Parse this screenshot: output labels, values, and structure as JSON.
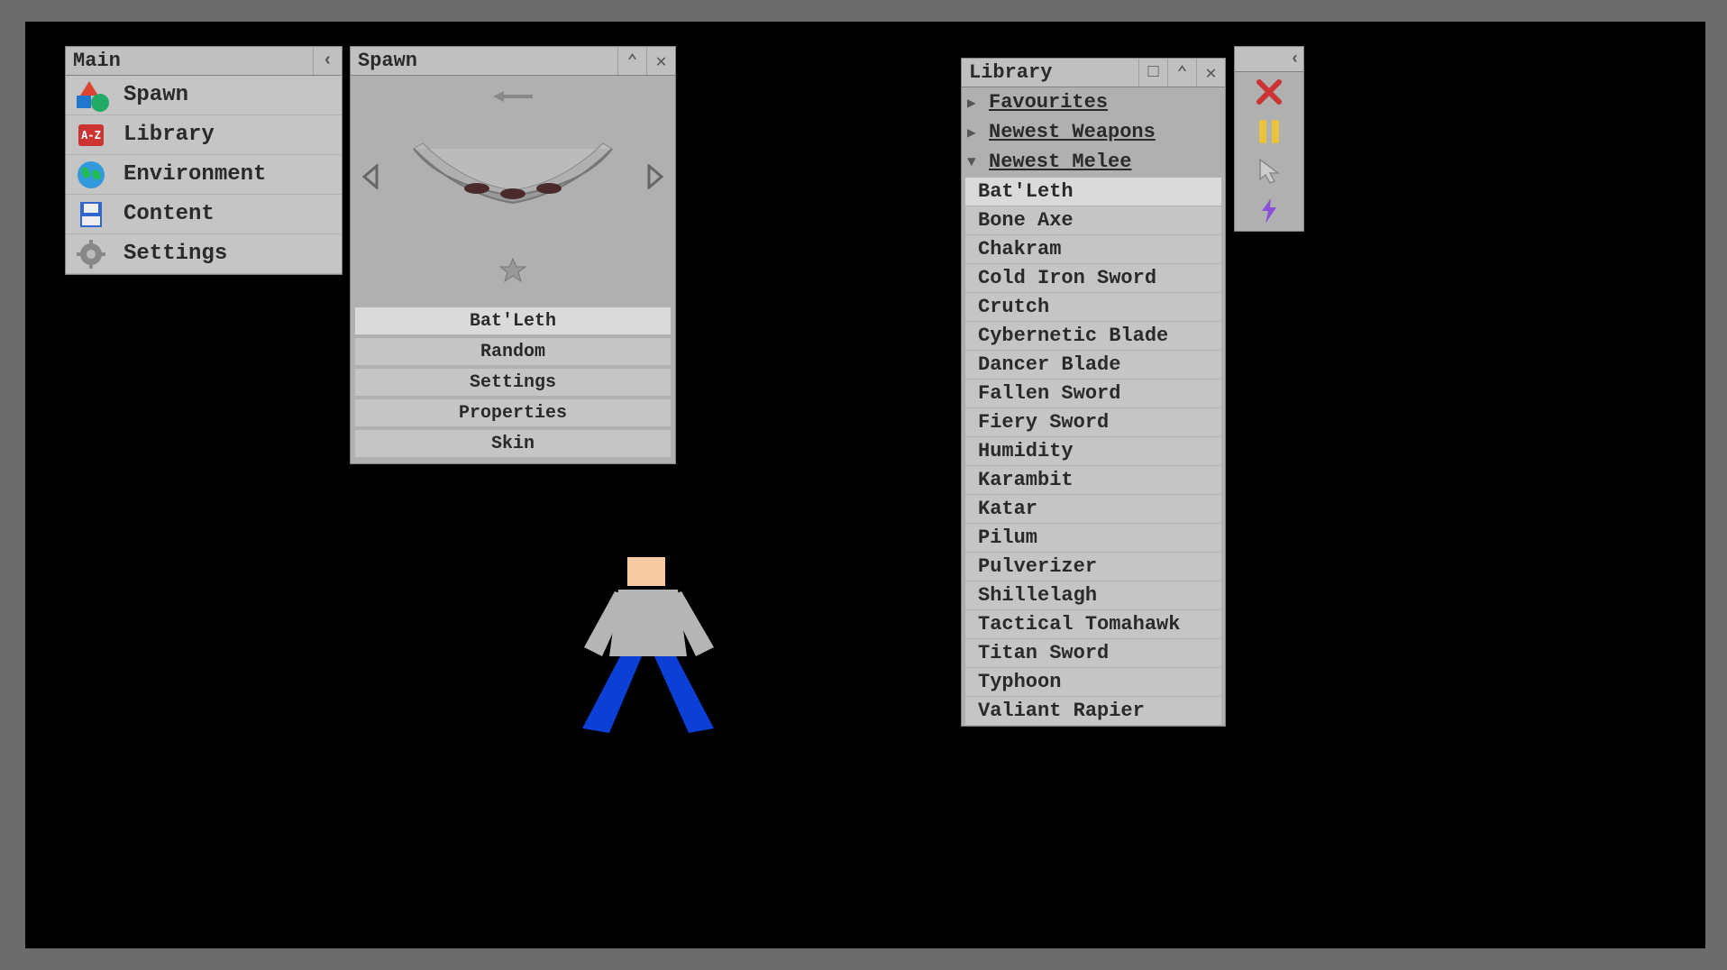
{
  "main": {
    "title": "Main",
    "items": [
      {
        "label": "Spawn",
        "icon": "shapes-icon"
      },
      {
        "label": "Library",
        "icon": "az-icon"
      },
      {
        "label": "Environment",
        "icon": "globe-icon"
      },
      {
        "label": "Content",
        "icon": "floppy-icon"
      },
      {
        "label": "Settings",
        "icon": "gear-icon"
      }
    ]
  },
  "spawn": {
    "title": "Spawn",
    "selected_item": "Bat'Leth",
    "buttons": [
      "Random",
      "Settings",
      "Properties",
      "Skin"
    ]
  },
  "library": {
    "title": "Library",
    "categories": [
      {
        "label": "Favourites",
        "expanded": false
      },
      {
        "label": "Newest Weapons",
        "expanded": false
      },
      {
        "label": "Newest Melee",
        "expanded": true
      }
    ],
    "items": [
      "Bat'Leth",
      "Bone Axe",
      "Chakram",
      "Cold Iron Sword",
      "Crutch",
      "Cybernetic Blade",
      "Dancer Blade",
      "Fallen Sword",
      "Fiery Sword",
      "Humidity",
      "Karambit",
      "Katar",
      "Pilum",
      "Pulverizer",
      "Shillelagh",
      "Tactical Tomahawk",
      "Titan Sword",
      "Typhoon",
      "Valiant Rapier"
    ],
    "selected": "Bat'Leth"
  }
}
